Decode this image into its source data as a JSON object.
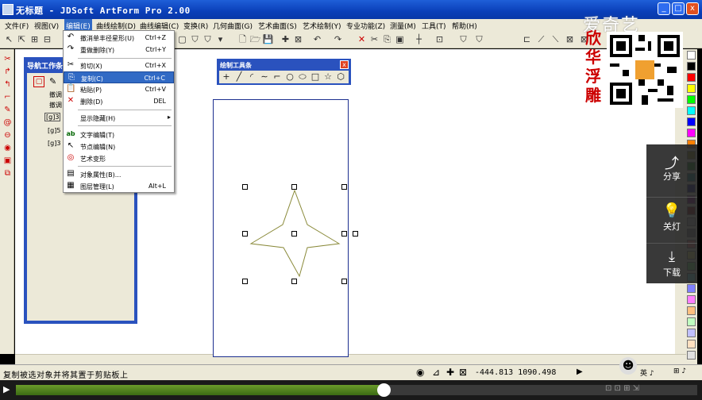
{
  "window": {
    "title": "无标题 - JDSoft ArtForm Pro 2.00",
    "controls": [
      "_",
      "□",
      "x"
    ]
  },
  "menubar": {
    "items": [
      "文件(F)",
      "视图(V)",
      "编辑(E)",
      "曲线绘制(D)",
      "曲线编辑(C)",
      "变换(R)",
      "几何曲面(G)",
      "艺术曲面(S)",
      "艺术绘制(Y)",
      "专业功能(Z)",
      "测量(M)",
      "工具(T)",
      "帮助(H)"
    ],
    "active_index": 2
  },
  "edit_menu": {
    "items": [
      {
        "icon": "undo-icon",
        "glyph": "↶",
        "label": "撤消单丰径星形(U)",
        "shortcut": "Ctrl+Z"
      },
      {
        "icon": "redo-icon",
        "glyph": "↷",
        "label": "重做删除(Y)",
        "shortcut": "Ctrl+Y"
      },
      {
        "icon": "cut-icon",
        "glyph": "✂",
        "label": "剪切(X)",
        "shortcut": "Ctrl+X"
      },
      {
        "icon": "copy-icon",
        "glyph": "⎘",
        "label": "复制(C)",
        "shortcut": "Ctrl+C",
        "highlighted": true
      },
      {
        "icon": "paste-icon",
        "glyph": "📋",
        "label": "粘贴(P)",
        "shortcut": "Ctrl+V"
      },
      {
        "icon": "delete-icon",
        "glyph": "✕",
        "label": "删除(D)",
        "shortcut": "DEL"
      },
      {
        "icon": "",
        "glyph": "",
        "label": "显示隐藏(H)",
        "shortcut": "",
        "submenu": true
      },
      {
        "icon": "text-edit-icon",
        "glyph": "ab",
        "label": "文字编辑(T)",
        "shortcut": ""
      },
      {
        "icon": "node-edit-icon",
        "glyph": "↖",
        "label": "节点编辑(N)",
        "shortcut": ""
      },
      {
        "icon": "art-transform-icon",
        "glyph": "◎",
        "label": "艺术变形",
        "shortcut": ""
      },
      {
        "icon": "properties-icon",
        "glyph": "▤",
        "label": "对象属性(B)...",
        "shortcut": ""
      },
      {
        "icon": "layer-manage-icon",
        "glyph": "▦",
        "label": "图层管理(L)",
        "shortcut": "Alt+L"
      }
    ]
  },
  "nav_panel": {
    "title": "导航工作条",
    "rows": [
      "撤调",
      "撤调",
      "[g]3",
      "[g]5",
      "[g]3"
    ]
  },
  "draw_toolbar": {
    "title": "绘制工具条",
    "close": "x",
    "tools": [
      {
        "name": "point-tool",
        "glyph": "+"
      },
      {
        "name": "line-tool",
        "glyph": "╱"
      },
      {
        "name": "arc-tool",
        "glyph": "◜"
      },
      {
        "name": "curve-tool",
        "glyph": "∼"
      },
      {
        "name": "polyline-tool",
        "glyph": "⌐"
      },
      {
        "name": "circle-tool",
        "glyph": "○"
      },
      {
        "name": "ellipse-tool",
        "glyph": "⬭"
      },
      {
        "name": "rectangle-tool",
        "glyph": "□"
      },
      {
        "name": "star-tool",
        "glyph": "☆"
      },
      {
        "name": "polygon-tool",
        "glyph": "⬡"
      }
    ]
  },
  "statusbar": {
    "message": "复制被选对象并将其置于剪贴板上",
    "coordinates": "-444.813 1090.498"
  },
  "share_panel": {
    "items": [
      {
        "icon": "share-icon",
        "glyph": "⤴",
        "label": "分享"
      },
      {
        "icon": "lightbulb-icon",
        "glyph": "💡",
        "label": "关灯"
      },
      {
        "icon": "download-icon",
        "glyph": "⤓",
        "label": "下载"
      }
    ]
  },
  "watermark": {
    "text": "爱奇艺",
    "vertical_text": "欣华浮雕"
  },
  "video": {
    "progress": 0.54
  },
  "colors": {
    "title_blue": "#0a3fb9",
    "menu_highlight": "#316ac5",
    "panel_blue": "#2a52be",
    "chrome": "#ece9d8",
    "star_stroke": "#8a8a3a",
    "progress_green": "#5a8b22"
  },
  "palette": [
    "#ffffff",
    "#000000",
    "#ff0000",
    "#ffff00",
    "#00ff00",
    "#00ffff",
    "#0000ff",
    "#ff00ff",
    "#ff8000",
    "#808000",
    "#008000",
    "#008080",
    "#000080",
    "#800080",
    "#800000",
    "#c0c0c0",
    "#808080",
    "#ff8080",
    "#ffff80",
    "#80ff80",
    "#80ffff",
    "#8080ff",
    "#ff80ff",
    "#ffc080",
    "#c0ffc0",
    "#c0c0ff",
    "#ffe0c0",
    "#e0e0e0"
  ]
}
